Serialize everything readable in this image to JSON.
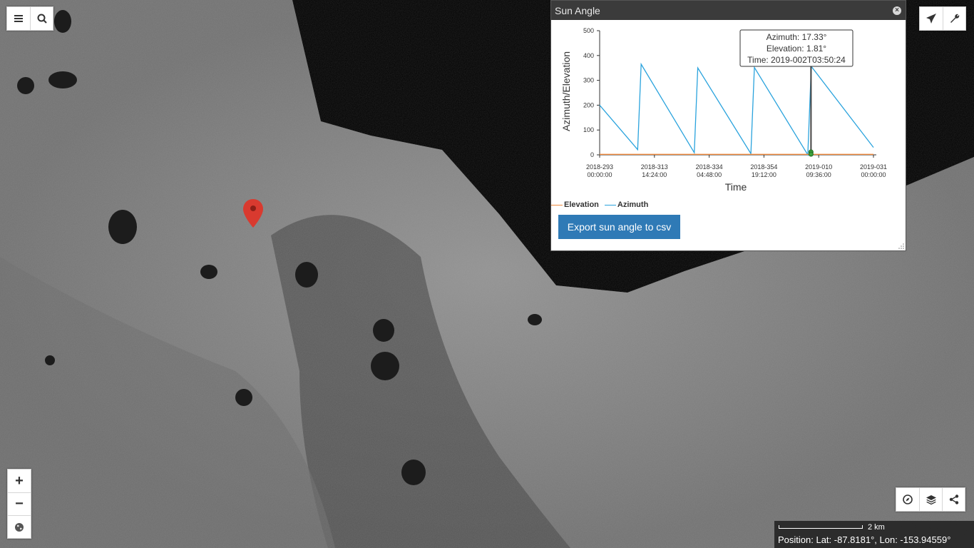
{
  "map": {
    "pin_color": "#d93a2f",
    "background": "lunar south pole terrain"
  },
  "toolbar_left": {
    "items": [
      {
        "name": "menu-icon",
        "label": "Menu"
      },
      {
        "name": "search-icon",
        "label": "Search"
      }
    ]
  },
  "toolbar_right": {
    "items": [
      {
        "name": "airplane-icon",
        "label": "Flight"
      },
      {
        "name": "wrench-icon",
        "label": "Tools"
      }
    ]
  },
  "zoom_controls": {
    "zoom_in": "+",
    "zoom_out": "−",
    "globe": "globe-icon"
  },
  "bottom_right_controls": {
    "items": [
      "compass-icon",
      "layers-icon",
      "share-icon"
    ]
  },
  "sun_panel": {
    "title": "Sun Angle",
    "close": "×",
    "tooltip": {
      "line1": "Azimuth: 17.33°",
      "line2": "Elevation: 1.81°",
      "line3": "Time: 2019-002T03:50:24"
    },
    "legend": {
      "elevation": "Elevation",
      "azimuth": "Azimuth",
      "elevation_color": "#f08a3c",
      "azimuth_color": "#2aa3dd"
    },
    "export_button": "Export sun angle to csv"
  },
  "chart_data": {
    "type": "line",
    "xlabel": "Time",
    "ylabel": "Azimuth/Elevation",
    "ylim": [
      0,
      500
    ],
    "yticks": [
      0,
      100,
      200,
      300,
      400,
      500
    ],
    "xticks": [
      {
        "line1": "2018-293",
        "line2": "00:00:00",
        "day": 0
      },
      {
        "line1": "2018-313",
        "line2": "14:24:00",
        "day": 20.6
      },
      {
        "line1": "2018-334",
        "line2": "04:48:00",
        "day": 41.2
      },
      {
        "line1": "2018-354",
        "line2": "19:12:00",
        "day": 61.8
      },
      {
        "line1": "2019-010",
        "line2": "09:36:00",
        "day": 82.4
      },
      {
        "line1": "2019-031",
        "line2": "00:00:00",
        "day": 103
      }
    ],
    "series": [
      {
        "name": "Azimuth",
        "points": [
          [
            0,
            200
          ],
          [
            14.3,
            21
          ],
          [
            15.6,
            365
          ],
          [
            35.6,
            9
          ],
          [
            36.9,
            350
          ],
          [
            56.9,
            5
          ],
          [
            58.2,
            352
          ],
          [
            78.3,
            0
          ],
          [
            79.6,
            356
          ],
          [
            103,
            30
          ]
        ]
      },
      {
        "name": "Elevation",
        "points": [
          [
            0,
            2
          ],
          [
            103,
            2
          ]
        ]
      }
    ],
    "hover_day": 79.5
  },
  "status": {
    "scale_label": "2 km",
    "position": "Position:  Lat: -87.8181°, Lon: -153.94559°"
  }
}
